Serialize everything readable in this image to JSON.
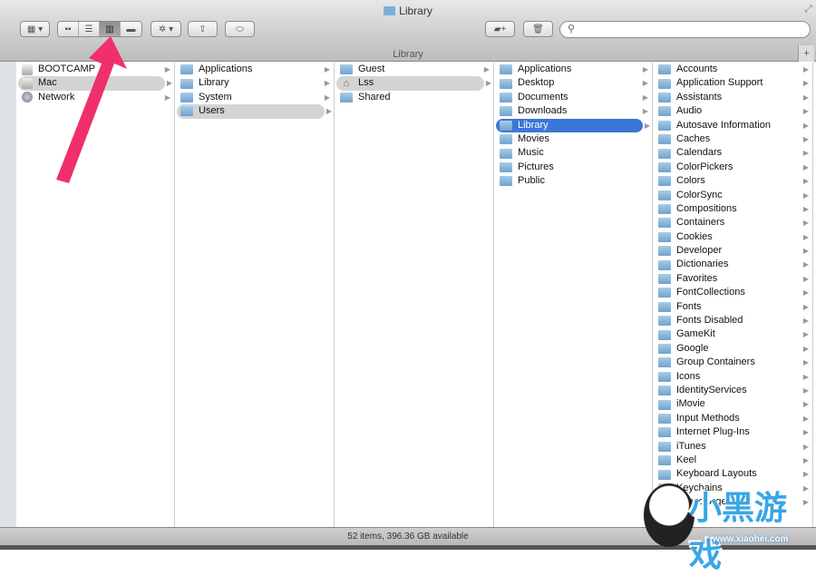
{
  "window": {
    "title": "Library",
    "path_label": "Library"
  },
  "toolbar": {
    "arrange": "▦ ▾",
    "views": [
      "▪▪",
      "☰",
      "▥",
      "▬"
    ],
    "action": "✲ ▾",
    "share": "⇪",
    "tags": "⬭",
    "new_folder": "▰+",
    "trash": "🗑",
    "search_placeholder": "",
    "search_icon": "⚲",
    "fullscreen": "⤢",
    "add": "+"
  },
  "columns": [
    {
      "items": [
        {
          "label": "BOOTCAMP",
          "icon": "disk"
        },
        {
          "label": "Mac",
          "icon": "disk",
          "state": "sel"
        },
        {
          "label": "Network",
          "icon": "net"
        }
      ]
    },
    {
      "items": [
        {
          "label": "Applications"
        },
        {
          "label": "Library"
        },
        {
          "label": "System"
        },
        {
          "label": "Users",
          "state": "sel"
        }
      ]
    },
    {
      "items": [
        {
          "label": "Guest"
        },
        {
          "label": "Lss",
          "icon": "home",
          "state": "sel"
        },
        {
          "label": "Shared"
        }
      ]
    },
    {
      "items": [
        {
          "label": "Applications"
        },
        {
          "label": "Desktop"
        },
        {
          "label": "Documents"
        },
        {
          "label": "Downloads"
        },
        {
          "label": "Library",
          "state": "act"
        },
        {
          "label": "Movies"
        },
        {
          "label": "Music"
        },
        {
          "label": "Pictures"
        },
        {
          "label": "Public"
        }
      ]
    },
    {
      "items": [
        {
          "label": "Accounts"
        },
        {
          "label": "Application Support"
        },
        {
          "label": "Assistants"
        },
        {
          "label": "Audio"
        },
        {
          "label": "Autosave Information"
        },
        {
          "label": "Caches"
        },
        {
          "label": "Calendars"
        },
        {
          "label": "ColorPickers"
        },
        {
          "label": "Colors"
        },
        {
          "label": "ColorSync"
        },
        {
          "label": "Compositions"
        },
        {
          "label": "Containers"
        },
        {
          "label": "Cookies"
        },
        {
          "label": "Developer"
        },
        {
          "label": "Dictionaries"
        },
        {
          "label": "Favorites"
        },
        {
          "label": "FontCollections"
        },
        {
          "label": "Fonts"
        },
        {
          "label": "Fonts Disabled"
        },
        {
          "label": "GameKit"
        },
        {
          "label": "Google"
        },
        {
          "label": "Group Containers"
        },
        {
          "label": "Icons"
        },
        {
          "label": "IdentityServices"
        },
        {
          "label": "iMovie"
        },
        {
          "label": "Input Methods"
        },
        {
          "label": "Internet Plug-Ins"
        },
        {
          "label": "iTunes"
        },
        {
          "label": "Keel"
        },
        {
          "label": "Keyboard Layouts"
        },
        {
          "label": "Keychains"
        },
        {
          "label": "LaunchAgents"
        }
      ]
    }
  ],
  "status": "52 items, 396.36 GB available",
  "watermark": {
    "brand": "小黑游戏",
    "url": "www.xiaohei.com"
  },
  "colors": {
    "selection": "#3a77d6",
    "arrow": "#f0306a"
  }
}
